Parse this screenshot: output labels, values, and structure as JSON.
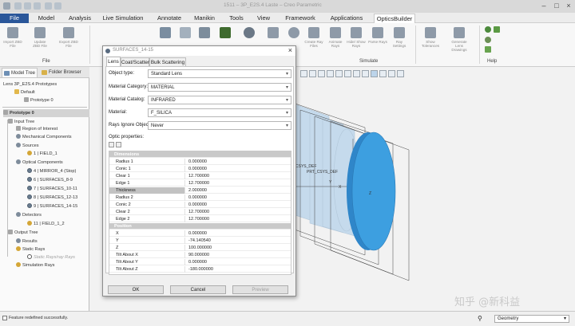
{
  "window": {
    "title": "1511 ‒ 3P_E2S.4 Laste – Creo Parametric"
  },
  "ribbon_tabs": [
    {
      "label": "File"
    },
    {
      "label": "Model"
    },
    {
      "label": "Analysis"
    },
    {
      "label": "Live Simulation"
    },
    {
      "label": "Annotate"
    },
    {
      "label": "Manikin"
    },
    {
      "label": "Tools"
    },
    {
      "label": "View"
    },
    {
      "label": "Framework"
    },
    {
      "label": "Applications"
    },
    {
      "label": "OpticsBuilder"
    }
  ],
  "ribbon": {
    "file_buttons": [
      {
        "label": "Import ZBD File",
        "icon": "import-icon"
      },
      {
        "label": "Update ZBD File",
        "icon": "update-icon"
      },
      {
        "label": "Export ZBD File",
        "icon": "export-icon"
      }
    ],
    "groups": {
      "file": "File",
      "simulate": "Simulate",
      "help": "Help"
    },
    "simulate_buttons": [
      {
        "label": "Create Ray Files",
        "icon": "create-ray-files-icon"
      },
      {
        "label": "Animate Rays",
        "icon": "animate-rays-icon"
      },
      {
        "label": "Hide/ Show Rays",
        "icon": "hide-show-rays-icon"
      },
      {
        "label": "Parse Rays",
        "icon": "parse-rays-icon"
      },
      {
        "label": "Ray Settings",
        "icon": "ray-settings-icon"
      },
      {
        "label": "Show Tolerances",
        "icon": "show-tolerances-icon"
      },
      {
        "label": "Generate Lens Drawings",
        "icon": "lens-drawings-icon"
      }
    ]
  },
  "tree_tabs": [
    "Model Tree",
    "Folder Browser"
  ],
  "tree": {
    "top": [
      {
        "label": "Lens 3P_E2S.4 Prototypes"
      },
      {
        "label": "Default"
      },
      {
        "label": "Prototype 0"
      }
    ],
    "prototype": "Prototype 0",
    "nodes": [
      {
        "label": "Input Tree"
      },
      {
        "label": "Region of Interest"
      },
      {
        "label": "Mechanical Components"
      },
      {
        "label": "Sources"
      },
      {
        "label": "1 | FIELD_1"
      },
      {
        "label": "Optical Components"
      },
      {
        "label": "4 | MIRROR_4 (Stop)"
      },
      {
        "label": "6 | SURFACES_8-9"
      },
      {
        "label": "7 | SURFACES_10-11"
      },
      {
        "label": "8 | SURFACES_12-13"
      },
      {
        "label": "9 | SURFACES_14-15"
      },
      {
        "label": "Detectors"
      },
      {
        "label": "11 | FIELD_1_2"
      },
      {
        "label": "Output Tree"
      },
      {
        "label": "Results"
      },
      {
        "label": "Static Rays"
      },
      {
        "label": "Static Rays/ray Rays"
      },
      {
        "label": "Simulation Rays"
      }
    ]
  },
  "viewport": {
    "labels": [
      "CSYS_DEF",
      "PRT_CSYS_DEF",
      "Y",
      "X",
      "Z"
    ]
  },
  "dialog": {
    "title": "SURFACES_14-15",
    "tabs": [
      "Lens",
      "Coat/Scatter",
      "Bulk Scattering"
    ],
    "fields": [
      {
        "label": "Object type:",
        "value": "Standard Lens"
      },
      {
        "label": "Material Category:",
        "value": "MATERIAL"
      },
      {
        "label": "Material Catalog:",
        "value": "INFRARED"
      },
      {
        "label": "Material:",
        "value": "F_SILICA"
      },
      {
        "label": "Rays Ignore Object:",
        "value": "Never"
      }
    ],
    "properties_label": "Optic properties:",
    "groups": [
      {
        "name": "Dimensions",
        "rows": [
          {
            "k": "Radius 1",
            "v": "0.000000"
          },
          {
            "k": "Conic 1",
            "v": "0.000000"
          },
          {
            "k": "Clear 1",
            "v": "12.700000"
          },
          {
            "k": "Edge 1",
            "v": "12.700000"
          },
          {
            "k": "Thickness",
            "v": "2.000000"
          },
          {
            "k": "Radius 2",
            "v": "0.000000"
          },
          {
            "k": "Conic 2",
            "v": "0.000000"
          },
          {
            "k": "Clear 2",
            "v": "12.700000"
          },
          {
            "k": "Edge 2",
            "v": "12.700000"
          }
        ]
      },
      {
        "name": "Position",
        "rows": [
          {
            "k": "X",
            "v": "0.000000"
          },
          {
            "k": "Y",
            "v": "-74.140540"
          },
          {
            "k": "Z",
            "v": "100.000000"
          },
          {
            "k": "Tilt About X",
            "v": "90.000000"
          },
          {
            "k": "Tilt About Y",
            "v": "0.000000"
          },
          {
            "k": "Tilt About Z",
            "v": "-180.000000"
          }
        ]
      }
    ],
    "buttons": {
      "ok": "OK",
      "cancel": "Cancel",
      "preview": "Preview"
    }
  },
  "status": {
    "message": "Feature redefined successfully.",
    "filter": "Geometry"
  },
  "watermark": "知乎 @新科益",
  "colors": {
    "file_tab": "#2b579a",
    "lens_face": "#3d9fe0",
    "lens_ghost": "#b7d3ea"
  }
}
